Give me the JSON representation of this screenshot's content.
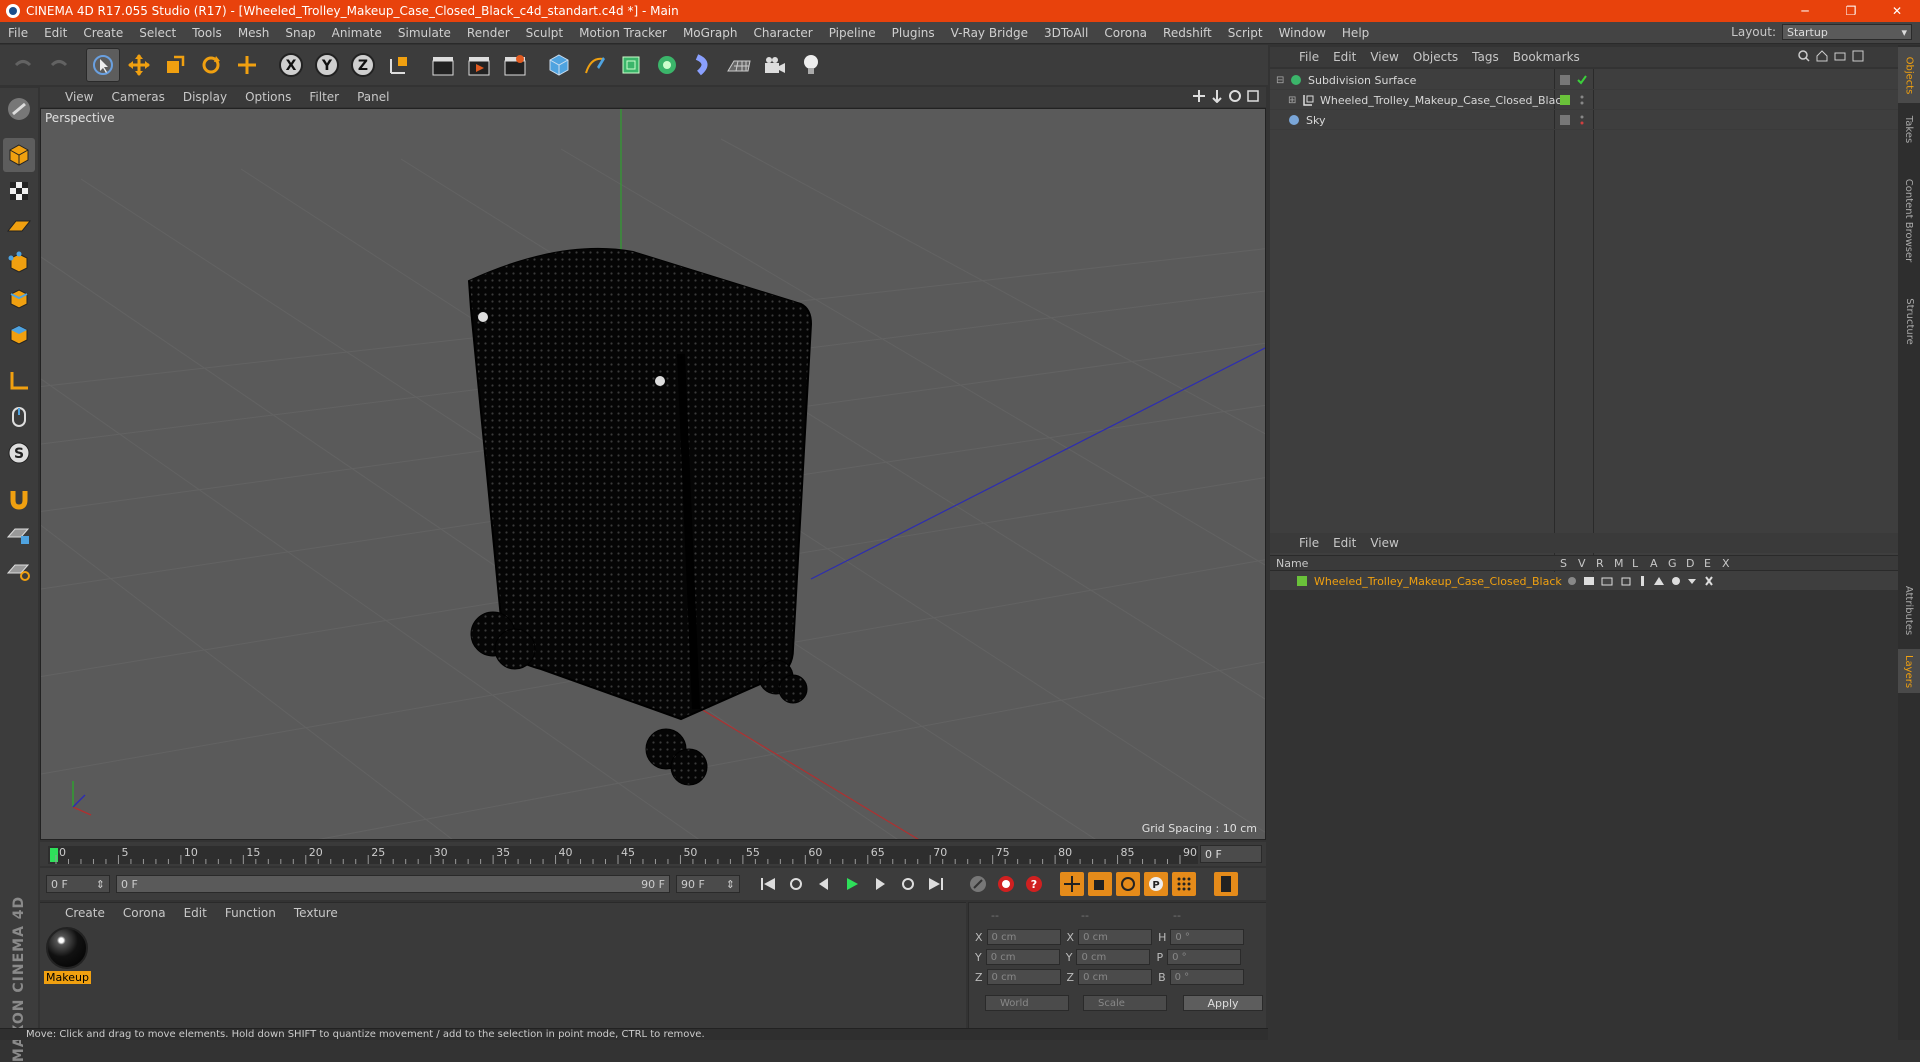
{
  "window": {
    "title": "CINEMA 4D R17.055 Studio (R17) - [Wheeled_Trolley_Makeup_Case_Closed_Black_c4d_standart.c4d *] - Main",
    "minimize": "─",
    "restore": "❐",
    "close": "✕"
  },
  "menubar": [
    "File",
    "Edit",
    "Create",
    "Select",
    "Tools",
    "Mesh",
    "Snap",
    "Animate",
    "Simulate",
    "Render",
    "Sculpt",
    "Motion Tracker",
    "MoGraph",
    "Character",
    "Pipeline",
    "Plugins",
    "V-Ray Bridge",
    "3DToAll",
    "Corona",
    "Redshift",
    "Script",
    "Window",
    "Help"
  ],
  "layout": {
    "label": "Layout:",
    "value": "Startup"
  },
  "viewport": {
    "menu": [
      "View",
      "Cameras",
      "Display",
      "Options",
      "Filter",
      "Panel"
    ],
    "camera": "Perspective",
    "grid_spacing": "Grid Spacing : 10 cm"
  },
  "timeline": {
    "ticks": [
      "0",
      "5",
      "10",
      "15",
      "20",
      "25",
      "30",
      "35",
      "40",
      "45",
      "50",
      "55",
      "60",
      "65",
      "70",
      "75",
      "80",
      "85",
      "90"
    ],
    "current_frame": "0 F"
  },
  "playback": {
    "start": "0 F",
    "range_start": "0 F",
    "range_end": "90 F",
    "end": "90 F"
  },
  "materials": {
    "menu": [
      "Create",
      "Corona",
      "Edit",
      "Function",
      "Texture"
    ],
    "items": [
      {
        "name": "Makeup"
      }
    ]
  },
  "coordinates": {
    "headers": [
      "--",
      "--",
      "--"
    ],
    "rows": [
      {
        "a": "X",
        "av": "0 cm",
        "b": "X",
        "bv": "0 cm",
        "c": "H",
        "cv": "0 °"
      },
      {
        "a": "Y",
        "av": "0 cm",
        "b": "Y",
        "bv": "0 cm",
        "c": "P",
        "cv": "0 °"
      },
      {
        "a": "Z",
        "av": "0 cm",
        "b": "Z",
        "bv": "0 cm",
        "c": "B",
        "cv": "0 °"
      }
    ],
    "space": "World",
    "mode": "Scale",
    "apply": "Apply"
  },
  "objects": {
    "menu": [
      "File",
      "Edit",
      "View",
      "Objects",
      "Tags",
      "Bookmarks"
    ],
    "items": [
      {
        "name": "Subdivision Surface"
      },
      {
        "name": "Wheeled_Trolley_Makeup_Case_Closed_Black"
      },
      {
        "name": "Sky"
      }
    ]
  },
  "layers": {
    "menu": [
      "File",
      "Edit",
      "View"
    ],
    "columns": [
      "Name",
      "S",
      "V",
      "R",
      "M",
      "L",
      "A",
      "G",
      "D",
      "E",
      "X"
    ],
    "items": [
      {
        "name": "Wheeled_Trolley_Makeup_Case_Closed_Black",
        "color": "#6ac23a"
      }
    ]
  },
  "side_tabs": [
    "Objects",
    "Takes",
    "Content Browser",
    "Structure",
    "Attributes",
    "Layers"
  ],
  "status": "Move: Click and drag to move elements. Hold down SHIFT to quantize movement / add to the selection in point mode, CTRL to remove.",
  "brand": "MAXON CINEMA 4D",
  "colors": {
    "accent": "#e8420c",
    "selection": "#f0a010"
  }
}
